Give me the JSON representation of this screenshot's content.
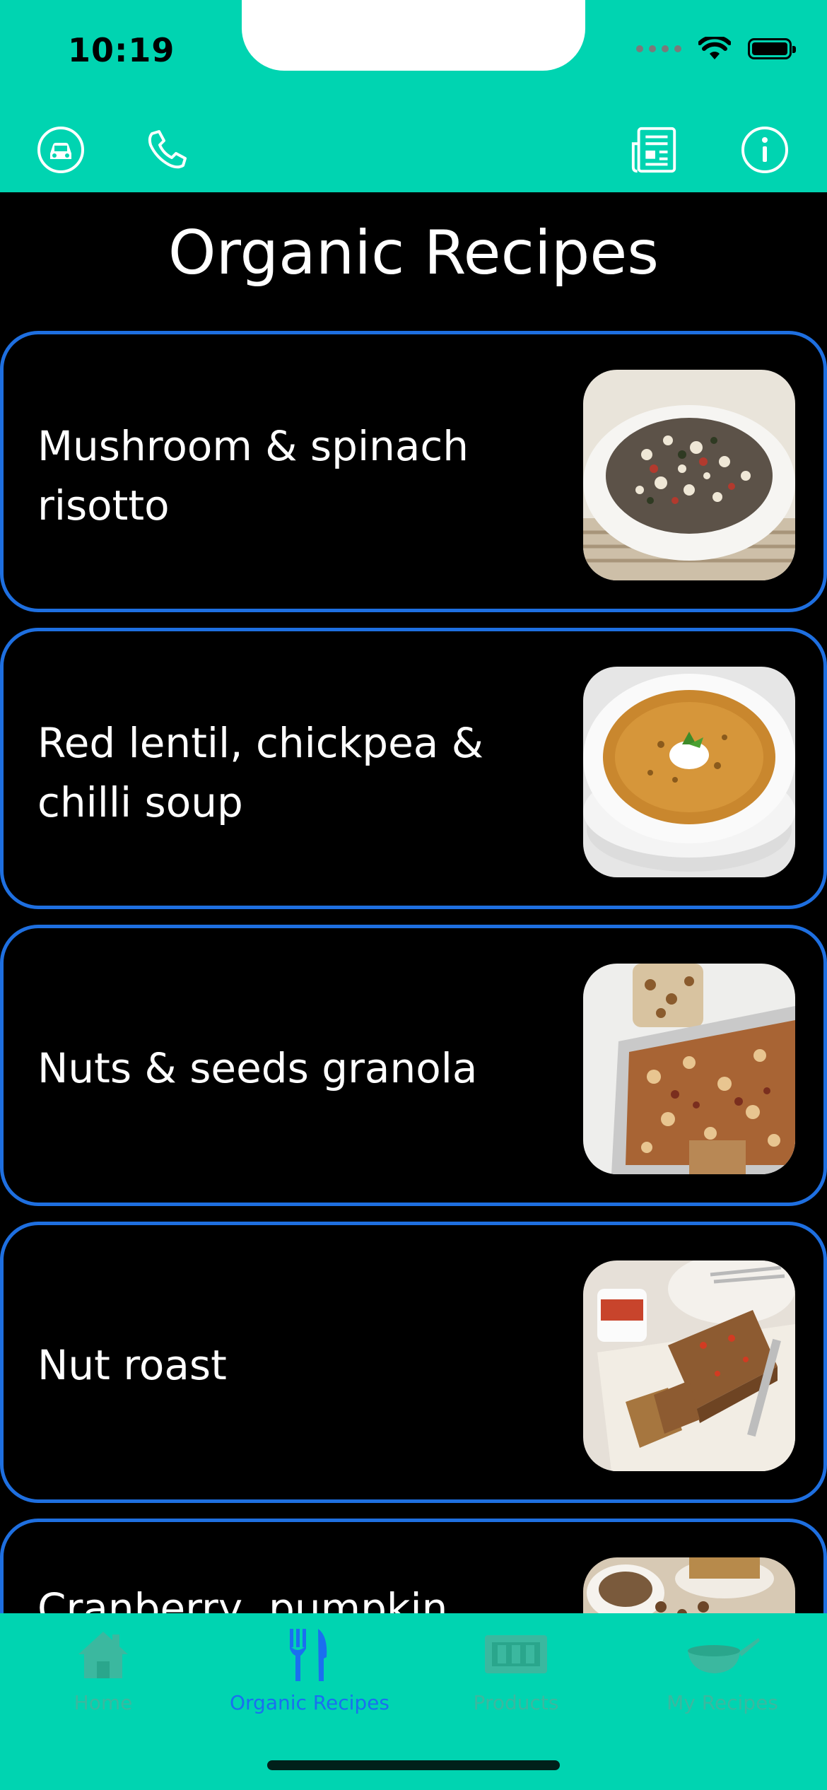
{
  "status": {
    "time": "10:19"
  },
  "header": {
    "icons": [
      "car-icon",
      "phone-icon",
      "newspaper-icon",
      "info-icon"
    ]
  },
  "page": {
    "title": "Organic Recipes"
  },
  "recipes": [
    {
      "title": "Mushroom & spinach risotto",
      "image": "risotto"
    },
    {
      "title": "Red lentil, chickpea & chilli soup",
      "image": "soup"
    },
    {
      "title": "Nuts & seeds granola",
      "image": "granola"
    },
    {
      "title": "Nut roast",
      "image": "nut-roast"
    },
    {
      "title": "Cranberry, pumpkin",
      "image": "cranberry"
    }
  ],
  "tabbar": {
    "tabs": [
      {
        "label": "Home",
        "icon": "house-icon",
        "active": false
      },
      {
        "label": "Organic Recipes",
        "icon": "fork-knife-icon",
        "active": true
      },
      {
        "label": "Products",
        "icon": "products-icon",
        "active": false
      },
      {
        "label": "My Recipes",
        "icon": "pan-icon",
        "active": false
      }
    ]
  },
  "colors": {
    "header_bg": "#00d4b1",
    "card_border": "#1e6fe0",
    "active_tab": "#1a6ff0",
    "inactive_tab": "#3bb89f"
  }
}
